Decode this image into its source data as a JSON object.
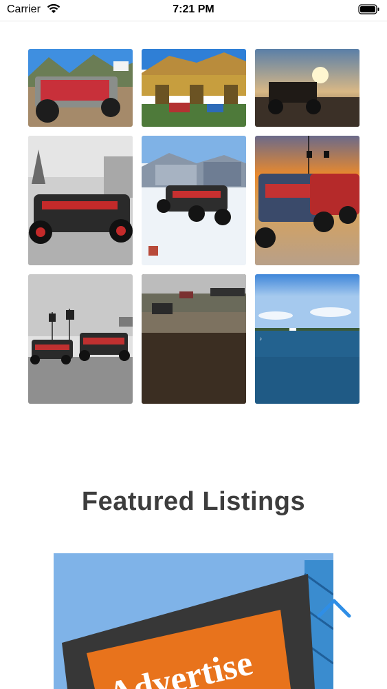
{
  "status_bar": {
    "carrier": "Carrier",
    "time": "7:21 PM"
  },
  "gallery": {
    "photos": [
      {
        "icon": "utv-photo"
      },
      {
        "icon": "utv-photo"
      },
      {
        "icon": "utv-photo"
      },
      {
        "icon": "utv-photo"
      },
      {
        "icon": "utv-photo"
      },
      {
        "icon": "utv-photo"
      },
      {
        "icon": "utv-photo"
      },
      {
        "icon": "utv-photo"
      },
      {
        "icon": "utv-photo"
      }
    ]
  },
  "featured": {
    "heading": "Featured Listings",
    "ad_sign_text": "Advertise"
  },
  "colors": {
    "heading": "#3d3d3d",
    "accent_arrow": "#2f8ee6",
    "sign_orange": "#e8731c"
  }
}
